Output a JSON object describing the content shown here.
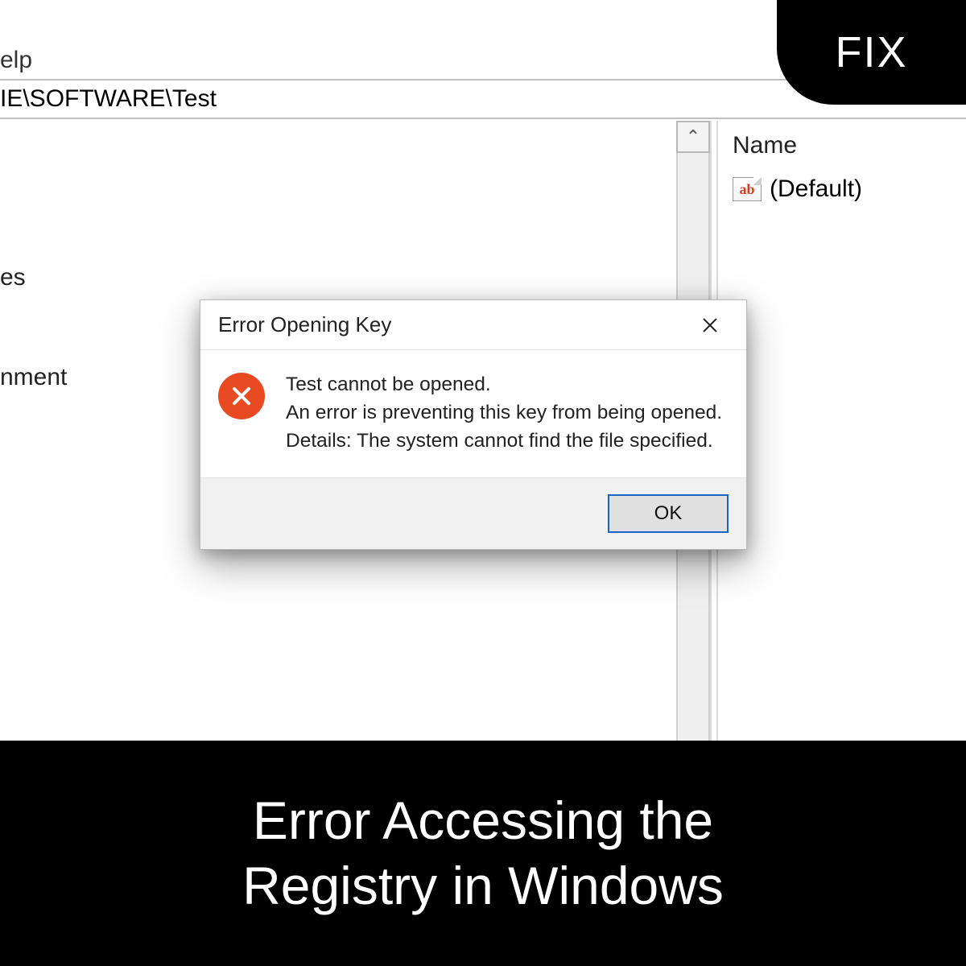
{
  "badge": {
    "label": "FIX"
  },
  "menu": {
    "help_label_fragment": "elp"
  },
  "path_bar": {
    "value_fragment": "IE\\SOFTWARE\\Test"
  },
  "tree": {
    "item1_fragment": "es",
    "item2_fragment": "nment"
  },
  "values_pane": {
    "column_header": "Name",
    "default_value_label": "(Default)",
    "ab_icon_text": "ab"
  },
  "dialog": {
    "title": "Error Opening Key",
    "line1": "Test cannot be opened.",
    "line2": "An error is preventing this key from being opened.",
    "line3": "Details: The system cannot find the file specified.",
    "ok_label": "OK"
  },
  "caption": {
    "line1": "Error Accessing the",
    "line2": "Registry in Windows"
  }
}
